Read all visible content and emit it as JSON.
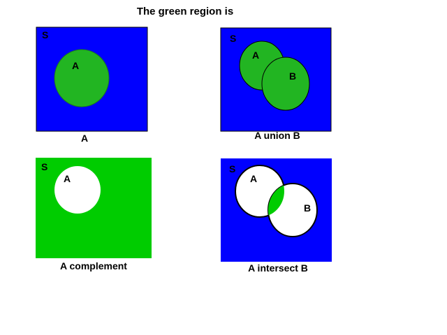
{
  "title": "The green region is",
  "colors": {
    "universe": "#0000ff",
    "region": "#22b522",
    "complement_region": "#00cc00",
    "empty": "#ffffff",
    "outline": "#000000"
  },
  "panels": [
    {
      "caption": "A",
      "universe_label": "S",
      "set_labels": [
        "A"
      ]
    },
    {
      "caption": "A union B",
      "universe_label": "S",
      "set_labels": [
        "A",
        "B"
      ]
    },
    {
      "caption": "A complement",
      "universe_label": "S",
      "set_labels": [
        "A"
      ]
    },
    {
      "caption": "A intersect B",
      "universe_label": "S",
      "set_labels": [
        "A",
        "B"
      ]
    }
  ]
}
